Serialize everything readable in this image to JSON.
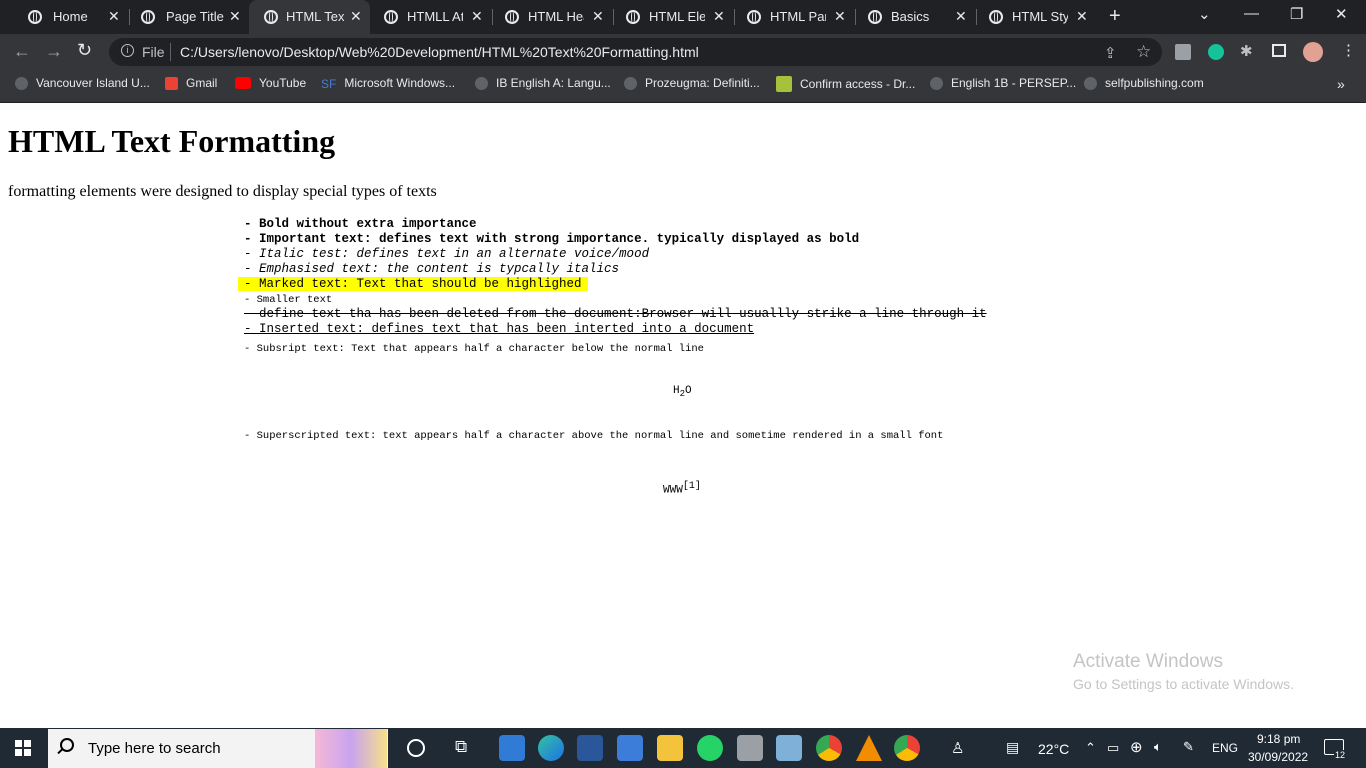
{
  "tabs": [
    {
      "label": "Home",
      "active": false
    },
    {
      "label": "Page Title",
      "active": false
    },
    {
      "label": "HTML Text",
      "active": true
    },
    {
      "label": "HTMLL Att",
      "active": false
    },
    {
      "label": "HTML Hea",
      "active": false
    },
    {
      "label": "HTML Elen",
      "active": false
    },
    {
      "label": "HTML Para",
      "active": false
    },
    {
      "label": "Basics",
      "active": false
    },
    {
      "label": "HTML Style",
      "active": false
    }
  ],
  "omnibox": {
    "scheme": "File",
    "url": "C:/Users/lenovo/Desktop/Web%20Development/HTML%20Text%20Formatting.html"
  },
  "bookmarks": [
    "Vancouver Island U...",
    "Gmail",
    "YouTube",
    "Microsoft Windows...",
    "IB English A: Langu...",
    "Prozeugma: Definiti...",
    "Confirm access - Dr...",
    "English 1B - PERSEP...",
    "selfpublishing.com"
  ],
  "page": {
    "heading": "HTML Text Formatting",
    "intro": "formatting elements were designed to display special types of texts",
    "lines": {
      "bold": "- Bold without extra importance",
      "strong": "- Important text: defines text with strong importance. typically displayed as bold",
      "italic": "- Italic test: defines text in an alternate voice/mood",
      "em": "- Emphasised text: the content is typcally italics",
      "mark": "- Marked text: Text that should be highlighed",
      "small": "- Smaller text",
      "del": "- define text tha has been deleted from the document:Browser will usuallly strike a line through it",
      "ins": "- Inserted text: defines text that has been interted into a document",
      "sub": "- Subsript text: Text that appears half a character below the normal line",
      "sup": "- Superscripted text: text appears half a character above the normal line and sometime rendered in a small font"
    },
    "sub_example": {
      "base": "H",
      "sub": "2",
      "tail": "O"
    },
    "sup_example": {
      "base": "WWW",
      "sup": "[1]"
    }
  },
  "watermark": {
    "title": "Activate Windows",
    "subtitle": "Go to Settings to activate Windows."
  },
  "taskbar": {
    "search_placeholder": "Type here to search",
    "weather": "22°C",
    "lang": "ENG",
    "time": "9:18 pm",
    "date": "30/09/2022",
    "notifications": "12"
  },
  "colors": {
    "tabstrip": "#202124",
    "toolbar": "#35363a",
    "highlight": "#ffff00",
    "taskbar": "#1f2a35"
  }
}
